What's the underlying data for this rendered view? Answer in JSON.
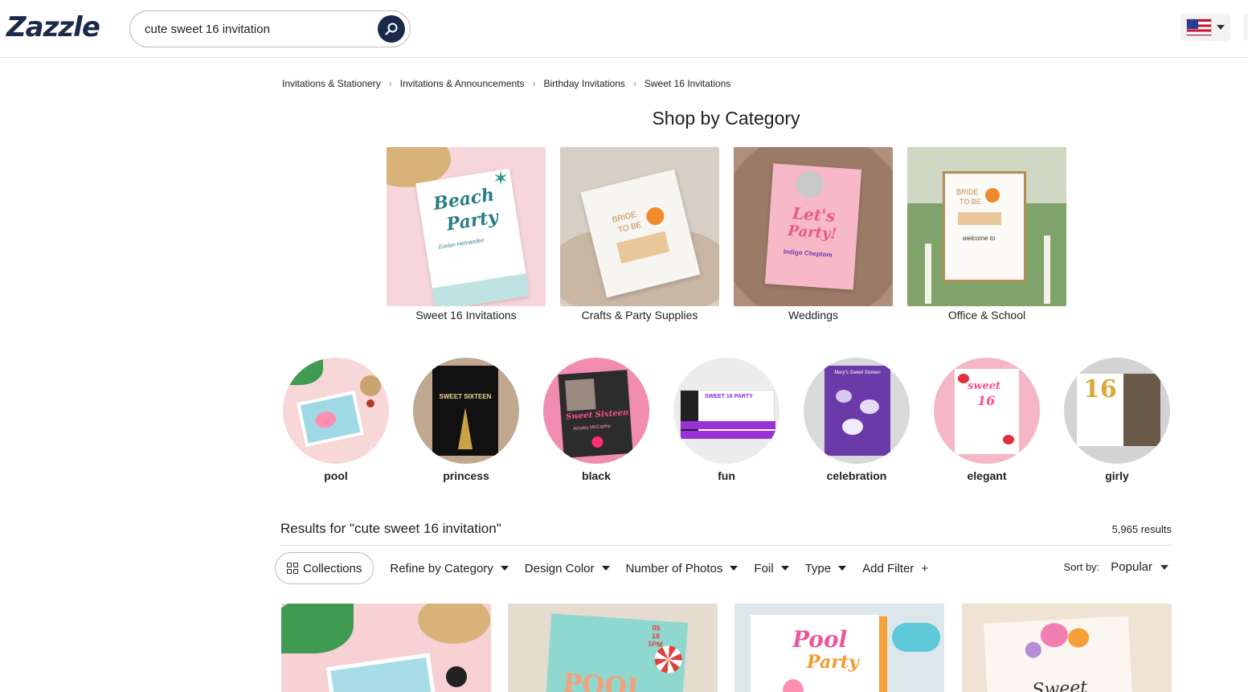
{
  "header": {
    "logo": "Zazzle",
    "search": {
      "value": "cute sweet 16 invitation"
    },
    "flag_icon": "us-flag-icon",
    "colors": {
      "brand": "#1b2a4a"
    }
  },
  "breadcrumb": [
    "Invitations & Stationery",
    "Invitations & Announcements",
    "Birthday Invitations",
    "Sweet 16 Invitations"
  ],
  "shop_by_category": {
    "title": "Shop by Category",
    "items": [
      {
        "label": "Sweet 16 Invitations",
        "art": {
          "main": "Beach",
          "sub": "Party",
          "name": "Evelyn Hernandez"
        }
      },
      {
        "label": "Crafts & Party Supplies",
        "art": {
          "main": "BRIDE",
          "sub": "TO BE"
        }
      },
      {
        "label": "Weddings",
        "art": {
          "main": "Let's",
          "sub": "Party!",
          "name": "Indigo Cheptom"
        }
      },
      {
        "label": "Office & School",
        "art": {
          "main": "BRIDE",
          "sub": "TO BE",
          "extra": "welcome to"
        }
      }
    ]
  },
  "styles": [
    {
      "label": "pool"
    },
    {
      "label": "princess",
      "art": "SWEET SIXTEEN"
    },
    {
      "label": "black",
      "art": "Sweet Sixteen",
      "name": "Ainsley McCarthy"
    },
    {
      "label": "fun",
      "art": "SWEET 16 PARTY"
    },
    {
      "label": "celebration",
      "art": "Mary's Sweet Sixteen"
    },
    {
      "label": "elegant",
      "art": "sweet",
      "num": "16"
    },
    {
      "label": "girly",
      "num": "16"
    }
  ],
  "results": {
    "title": "Results for \"cute sweet 16 invitation\"",
    "count": "5,965 results"
  },
  "filters": {
    "collections": "Collections",
    "items": [
      "Refine by Category",
      "Design Color",
      "Number of Photos",
      "Foil",
      "Type"
    ],
    "add_filter": "Add Filter",
    "add_symbol": "+",
    "sort_label": "Sort by:",
    "sort_value": "Popular"
  },
  "products": [
    {
      "art": ""
    },
    {
      "art": "POOL",
      "date": [
        "05",
        "18",
        "1PM"
      ]
    },
    {
      "art": "Pool",
      "sub": "Party"
    },
    {
      "art": "Sweet"
    }
  ]
}
